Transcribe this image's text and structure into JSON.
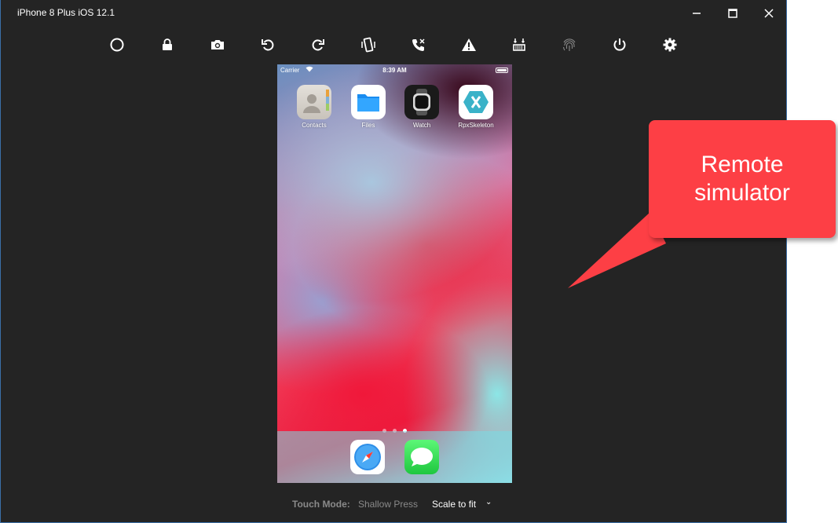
{
  "window": {
    "title": "iPhone 8 Plus iOS 12.1",
    "controls": [
      "minimize-icon",
      "maximize-icon",
      "close-icon"
    ]
  },
  "toolbar": {
    "buttons": [
      {
        "name": "home-button",
        "icon": "circle-icon"
      },
      {
        "name": "lock-button",
        "icon": "lock-icon"
      },
      {
        "name": "screenshot-button",
        "icon": "camera-icon"
      },
      {
        "name": "rotate-left-button",
        "icon": "rotate-left-icon"
      },
      {
        "name": "rotate-right-button",
        "icon": "rotate-right-icon"
      },
      {
        "name": "shake-button",
        "icon": "shake-icon"
      },
      {
        "name": "call-button",
        "icon": "phone-call-icon"
      },
      {
        "name": "warning-button",
        "icon": "warning-icon"
      },
      {
        "name": "location-button",
        "icon": "location-icon"
      },
      {
        "name": "touch-id-button",
        "icon": "fingerprint-icon"
      },
      {
        "name": "power-button",
        "icon": "power-icon"
      },
      {
        "name": "settings-button",
        "icon": "gear-icon"
      }
    ]
  },
  "phone": {
    "status": {
      "carrier": "Carrier",
      "time": "8:39 AM"
    },
    "apps": [
      {
        "label": "Contacts",
        "icon": "contacts-icon"
      },
      {
        "label": "Files",
        "icon": "files-icon"
      },
      {
        "label": "Watch",
        "icon": "watch-icon"
      },
      {
        "label": "RpxSkeleton",
        "icon": "xamarin-icon"
      }
    ],
    "page_dots": {
      "count": 3,
      "active": 2
    },
    "dock": [
      {
        "icon": "safari-icon"
      },
      {
        "icon": "messages-icon"
      }
    ]
  },
  "bottom": {
    "touch_mode_label": "Touch Mode:",
    "touch_mode_value": "Shallow Press",
    "scale_value": "Scale to fit"
  },
  "callout": {
    "line1": "Remote",
    "line2": "simulator"
  },
  "colors": {
    "window_bg": "#242424",
    "callout": "#fd3f45",
    "border": "#3b6fa8"
  }
}
